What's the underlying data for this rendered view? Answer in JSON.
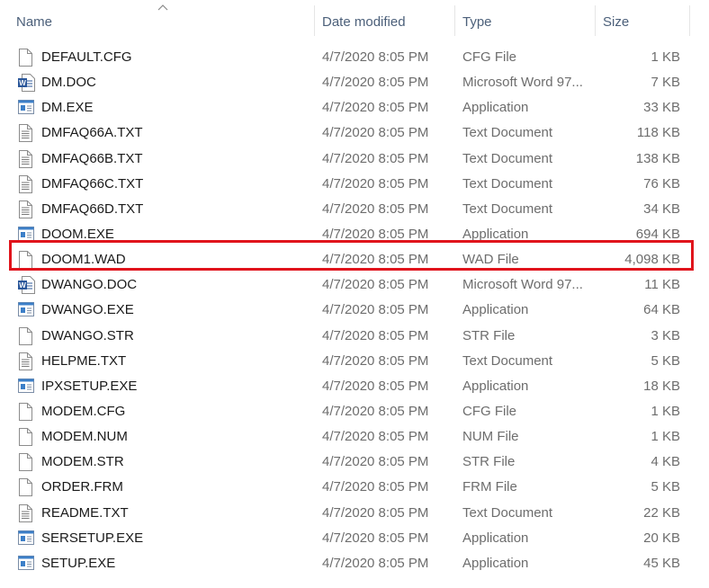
{
  "columns": {
    "name": "Name",
    "date": "Date modified",
    "type": "Type",
    "size": "Size"
  },
  "sort_indicator": "chevron-up-icon",
  "highlight_color": "#e0141c",
  "files": [
    {
      "name": "DEFAULT.CFG",
      "date": "4/7/2020 8:05 PM",
      "type": "CFG File",
      "size": "1 KB",
      "icon": "file-icon"
    },
    {
      "name": "DM.DOC",
      "date": "4/7/2020 8:05 PM",
      "type": "Microsoft Word 97...",
      "size": "7 KB",
      "icon": "word-doc-icon"
    },
    {
      "name": "DM.EXE",
      "date": "4/7/2020 8:05 PM",
      "type": "Application",
      "size": "33 KB",
      "icon": "application-icon"
    },
    {
      "name": "DMFAQ66A.TXT",
      "date": "4/7/2020 8:05 PM",
      "type": "Text Document",
      "size": "118 KB",
      "icon": "text-file-icon"
    },
    {
      "name": "DMFAQ66B.TXT",
      "date": "4/7/2020 8:05 PM",
      "type": "Text Document",
      "size": "138 KB",
      "icon": "text-file-icon"
    },
    {
      "name": "DMFAQ66C.TXT",
      "date": "4/7/2020 8:05 PM",
      "type": "Text Document",
      "size": "76 KB",
      "icon": "text-file-icon"
    },
    {
      "name": "DMFAQ66D.TXT",
      "date": "4/7/2020 8:05 PM",
      "type": "Text Document",
      "size": "34 KB",
      "icon": "text-file-icon"
    },
    {
      "name": "DOOM.EXE",
      "date": "4/7/2020 8:05 PM",
      "type": "Application",
      "size": "694 KB",
      "icon": "application-icon"
    },
    {
      "name": "DOOM1.WAD",
      "date": "4/7/2020 8:05 PM",
      "type": "WAD File",
      "size": "4,098 KB",
      "icon": "file-icon",
      "highlighted": true
    },
    {
      "name": "DWANGO.DOC",
      "date": "4/7/2020 8:05 PM",
      "type": "Microsoft Word 97...",
      "size": "11 KB",
      "icon": "word-doc-icon"
    },
    {
      "name": "DWANGO.EXE",
      "date": "4/7/2020 8:05 PM",
      "type": "Application",
      "size": "64 KB",
      "icon": "application-icon"
    },
    {
      "name": "DWANGO.STR",
      "date": "4/7/2020 8:05 PM",
      "type": "STR File",
      "size": "3 KB",
      "icon": "file-icon"
    },
    {
      "name": "HELPME.TXT",
      "date": "4/7/2020 8:05 PM",
      "type": "Text Document",
      "size": "5 KB",
      "icon": "text-file-icon"
    },
    {
      "name": "IPXSETUP.EXE",
      "date": "4/7/2020 8:05 PM",
      "type": "Application",
      "size": "18 KB",
      "icon": "application-icon"
    },
    {
      "name": "MODEM.CFG",
      "date": "4/7/2020 8:05 PM",
      "type": "CFG File",
      "size": "1 KB",
      "icon": "file-icon"
    },
    {
      "name": "MODEM.NUM",
      "date": "4/7/2020 8:05 PM",
      "type": "NUM File",
      "size": "1 KB",
      "icon": "file-icon"
    },
    {
      "name": "MODEM.STR",
      "date": "4/7/2020 8:05 PM",
      "type": "STR File",
      "size": "4 KB",
      "icon": "file-icon"
    },
    {
      "name": "ORDER.FRM",
      "date": "4/7/2020 8:05 PM",
      "type": "FRM File",
      "size": "5 KB",
      "icon": "file-icon"
    },
    {
      "name": "README.TXT",
      "date": "4/7/2020 8:05 PM",
      "type": "Text Document",
      "size": "22 KB",
      "icon": "text-file-icon"
    },
    {
      "name": "SERSETUP.EXE",
      "date": "4/7/2020 8:05 PM",
      "type": "Application",
      "size": "20 KB",
      "icon": "application-icon"
    },
    {
      "name": "SETUP.EXE",
      "date": "4/7/2020 8:05 PM",
      "type": "Application",
      "size": "45 KB",
      "icon": "application-icon"
    }
  ]
}
